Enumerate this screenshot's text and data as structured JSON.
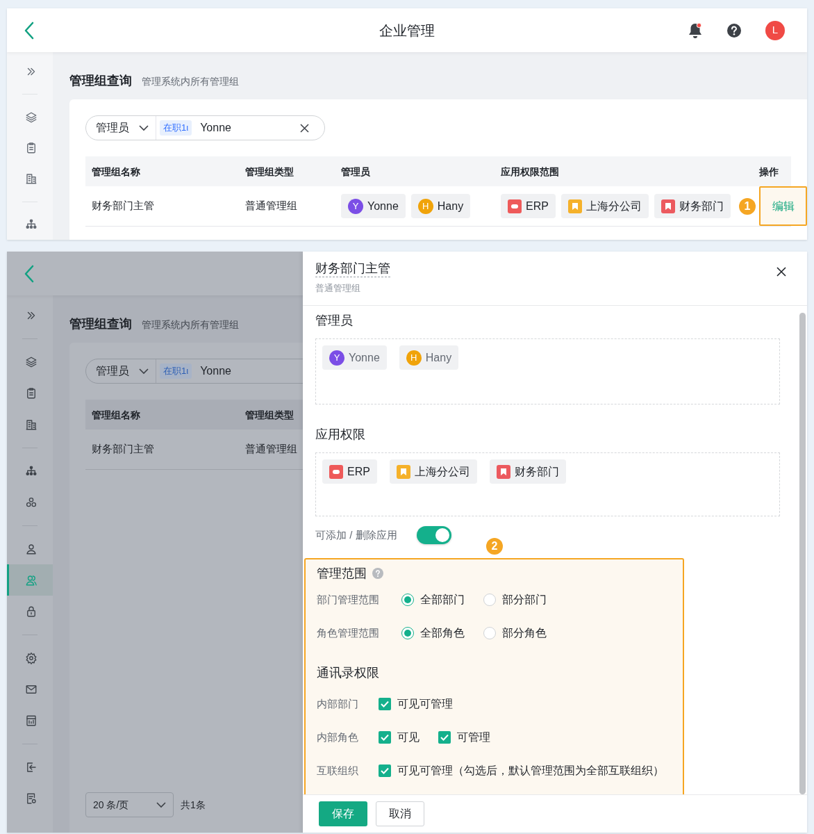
{
  "list_view": {
    "header": {
      "title": "企业管理",
      "avatar": "L"
    },
    "sidebar": [
      {
        "kind": "expand",
        "selected": false
      },
      {
        "kind": "divider"
      },
      {
        "kind": "layers",
        "selected": false
      },
      {
        "kind": "clipboard",
        "selected": false
      },
      {
        "kind": "building",
        "selected": false
      },
      {
        "kind": "divider"
      },
      {
        "kind": "org",
        "selected": false
      }
    ],
    "page_title": "管理组查询",
    "page_subtitle": "管理系统内所有管理组",
    "filter": {
      "field": "管理员",
      "tag": "在职1ι",
      "value": "Yonne"
    },
    "table": {
      "columns": [
        "管理组名称",
        "管理组类型",
        "管理员",
        "应用权限范围",
        "操作"
      ],
      "rows": [
        {
          "cells": [
            {
              "kind": "text",
              "text": "财务部门主管"
            },
            {
              "kind": "text",
              "text": "普通管理组"
            },
            {
              "kind": "people",
              "people": [
                {
                  "initial": "Y",
                  "name": "Yonne",
                  "color": "#7b4ee6"
                },
                {
                  "initial": "H",
                  "name": "Hany",
                  "color": "#f0a30a"
                }
              ]
            },
            {
              "kind": "apps",
              "apps": [
                {
                  "name": "ERP",
                  "kind": "erp",
                  "color": "#ee5a5a"
                },
                {
                  "name": "上海分公司",
                  "kind": "bookmark",
                  "color": "#f5b12a"
                },
                {
                  "name": "财务部门",
                  "kind": "bookmark",
                  "color": "#ec5a5f"
                }
              ]
            },
            {
              "kind": "action",
              "text": "编辑",
              "highlighted": true,
              "marker": "1"
            }
          ]
        }
      ]
    }
  },
  "edit_view": {
    "background": {
      "sidebar": [
        {
          "kind": "expand",
          "selected": false
        },
        {
          "kind": "divider"
        },
        {
          "kind": "layers",
          "selected": false
        },
        {
          "kind": "clipboard",
          "selected": false
        },
        {
          "kind": "building",
          "selected": false
        },
        {
          "kind": "divider"
        },
        {
          "kind": "org",
          "selected": false
        },
        {
          "kind": "triad",
          "selected": false
        },
        {
          "kind": "divider"
        },
        {
          "kind": "user",
          "selected": false
        },
        {
          "kind": "users",
          "selected": true
        },
        {
          "kind": "lock",
          "selected": false
        },
        {
          "kind": "divider"
        },
        {
          "kind": "gear",
          "selected": false
        },
        {
          "kind": "mail",
          "selected": false
        },
        {
          "kind": "calc",
          "selected": false
        },
        {
          "kind": "divider"
        },
        {
          "kind": "logout",
          "selected": false
        },
        {
          "kind": "doc",
          "selected": false
        }
      ],
      "page_title": "管理组查询",
      "page_subtitle": "管理系统内所有管理组",
      "filter": {
        "field": "管理员",
        "tag": "在职1ι",
        "value": "Yonne"
      },
      "table": {
        "columns": [
          "管理组名称",
          "管理组类型"
        ],
        "rows": [
          {
            "cells": [
              {
                "kind": "text",
                "text": "财务部门主管"
              },
              {
                "kind": "text",
                "text": "普通管理组"
              }
            ]
          }
        ]
      },
      "pagination": {
        "page_size": "20 条/页",
        "total": "共1条"
      }
    },
    "drawer": {
      "title": "财务部门主管",
      "subtitle": "普通管理组",
      "sections": [
        {
          "heading": "管理员",
          "kind": "people",
          "people": [
            {
              "initial": "Y",
              "name": "Yonne",
              "color": "#7b4ee6"
            },
            {
              "initial": "H",
              "name": "Hany",
              "color": "#f0a30a"
            }
          ]
        },
        {
          "heading": "应用权限",
          "kind": "apps",
          "apps": [
            {
              "name": "ERP",
              "kind": "erp",
              "color": "#ee5a5a"
            },
            {
              "name": "上海分公司",
              "kind": "bookmark",
              "color": "#f5b12a"
            },
            {
              "name": "财务部门",
              "kind": "bookmark",
              "color": "#ec5a5f"
            }
          ]
        }
      ],
      "toggle": {
        "label": "可添加 / 删除应用",
        "on": true
      },
      "scope": {
        "marker": "2",
        "highlighted": true,
        "heading": "管理范围",
        "rows": [
          {
            "label": "部门管理范围",
            "options": [
              {
                "label": "全部部门",
                "selected": true
              },
              {
                "label": "部分部门",
                "selected": false
              }
            ]
          },
          {
            "label": "角色管理范围",
            "options": [
              {
                "label": "全部角色",
                "selected": true
              },
              {
                "label": "部分角色",
                "selected": false
              }
            ]
          }
        ],
        "contacts_heading": "通讯录权限",
        "contacts": [
          {
            "label": "内部部门",
            "options": [
              {
                "label": "可见可管理",
                "checked": true
              }
            ]
          },
          {
            "label": "内部角色",
            "options": [
              {
                "label": "可见",
                "checked": true
              },
              {
                "label": "可管理",
                "checked": true
              }
            ]
          },
          {
            "label": "互联组织",
            "options": [
              {
                "label": "可见可管理（勾选后，默认管理范围为全部互联组织）",
                "checked": true
              }
            ]
          }
        ]
      },
      "buttons": [
        {
          "label": "保存",
          "kind": "primary"
        },
        {
          "label": "取消",
          "kind": "secondary"
        }
      ]
    }
  }
}
